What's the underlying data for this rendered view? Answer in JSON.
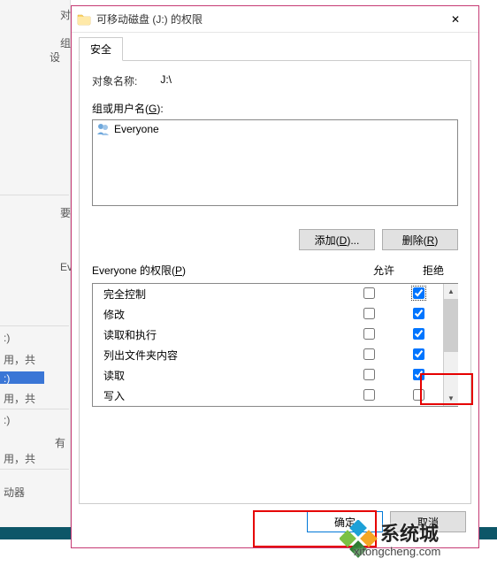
{
  "background": {
    "t1": "对",
    "t2": "组",
    "t3": "设",
    "t4": "要",
    "t5": "Ev",
    "r1a": ":)",
    "r1b": "用，共",
    "r2a": ":)",
    "r2b": "用，共",
    "r3a": ":)",
    "r3b": "有",
    "r4": "用，共",
    "dev": "动器"
  },
  "dialog": {
    "title": "可移动磁盘 (J:) 的权限",
    "close_glyph": "✕",
    "tab_security": "安全",
    "object_label": "对象名称:",
    "object_value": "J:\\",
    "group_label_pre": "组或用户名(",
    "group_label_key": "G",
    "group_label_post": "):",
    "user_list": [
      "Everyone"
    ],
    "add_btn_pre": "添加(",
    "add_btn_key": "D",
    "add_btn_post": ")...",
    "remove_btn_pre": "删除(",
    "remove_btn_key": "R",
    "remove_btn_post": ")",
    "perm_title_pre": "Everyone 的权限(",
    "perm_title_key": "P",
    "perm_title_post": ")",
    "col_allow": "允许",
    "col_deny": "拒绝",
    "permissions": [
      {
        "name": "完全控制",
        "allow": false,
        "deny": true,
        "focus": true
      },
      {
        "name": "修改",
        "allow": false,
        "deny": true
      },
      {
        "name": "读取和执行",
        "allow": false,
        "deny": true
      },
      {
        "name": "列出文件夹内容",
        "allow": false,
        "deny": true
      },
      {
        "name": "读取",
        "allow": false,
        "deny": true
      },
      {
        "name": "写入",
        "allow": false,
        "deny": false
      }
    ],
    "ok_btn": "确定",
    "cancel_btn": "取消"
  },
  "watermark": {
    "brand": "系统城",
    "url": "xitongcheng.com"
  }
}
